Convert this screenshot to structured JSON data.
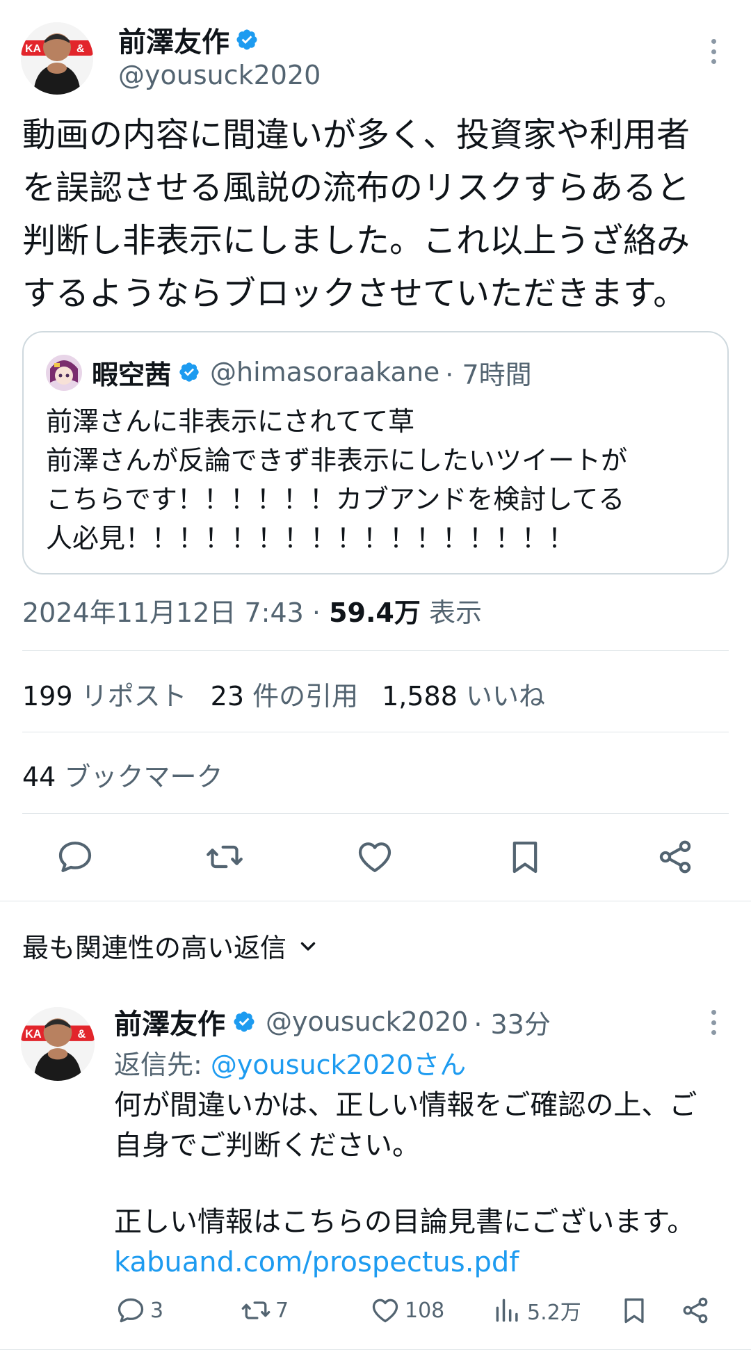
{
  "main_tweet": {
    "author_name": "前澤友作",
    "author_handle": "@yousuck2020",
    "body_lines": [
      "動画の内容に間違いが多く、投資家や利用者",
      "を誤認させる風説の流布のリスクすらあると",
      "判断し非表示にしました。これ以上うざ絡み",
      "するようならブロックさせていただきます。"
    ],
    "timestamp": "2024年11月12日 7:43",
    "separator": "·",
    "views_count": "59.4万",
    "views_label": "表示"
  },
  "quote_tweet": {
    "author_name": "暇空茜",
    "author_handle": "@himasoraakane",
    "time": "· 7時間",
    "lines": [
      "前澤さんに非表示にされてて草",
      "前澤さんが反論できず非表示にしたいツイートが",
      "こちらです！！！！！！カブアンドを検討してる",
      "人必見！！！！！！！！！！！！！！！！！"
    ]
  },
  "stats": {
    "reposts_count": "199",
    "reposts_label": "リポスト",
    "quotes_count": "23",
    "quotes_label": "件の引用",
    "likes_count": "1,588",
    "likes_label": "いいね",
    "bookmarks_count": "44",
    "bookmarks_label": "ブックマーク"
  },
  "replies_section": {
    "title": "最も関連性の高い返信"
  },
  "reply": {
    "author_name": "前澤友作",
    "author_handle": "@yousuck2020",
    "time": "· 33分",
    "reply_to_prefix": "返信先: ",
    "reply_to_handle": "@yousuck2020さん",
    "lines": [
      "何が間違いかは、正しい情報をご確認の上、ご",
      "自身でご判断ください。",
      "",
      "正しい情報はこちらの目論見書にございます。"
    ],
    "link_text": "kabuand.com/prospectus.pdf",
    "replies_count": "3",
    "reposts_count": "7",
    "likes_count": "108",
    "views_count": "5.2万"
  },
  "colors": {
    "accent": "#1d9bf0",
    "text": "#0f1419",
    "secondary": "#536471",
    "border": "#cfd9de"
  },
  "icons": {
    "verified": "verified-badge-icon",
    "reply": "reply-icon",
    "repost": "repost-icon",
    "like": "like-icon",
    "bookmark": "bookmark-icon",
    "share": "share-icon",
    "views": "views-icon",
    "more": "more-vertical-icon",
    "dropdown": "chevron-down-icon"
  }
}
